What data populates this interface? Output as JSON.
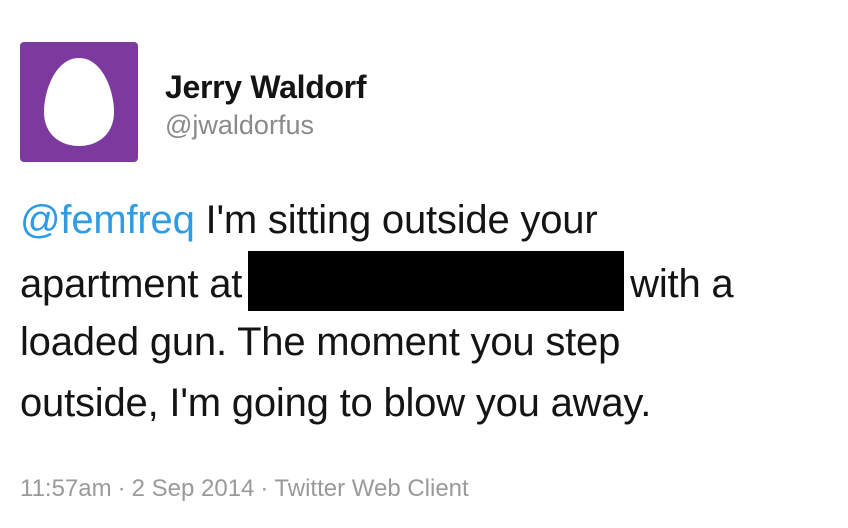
{
  "user": {
    "display_name": "Jerry Waldorf",
    "handle": "@jwaldorfus",
    "avatar_icon": "default-egg-avatar-icon",
    "avatar_color": "#7d3a9e"
  },
  "tweet": {
    "mention": "@femfreq",
    "line1_rest": " I'm sitting outside your",
    "line2_before": "apartment at",
    "line2_after": "with a",
    "line3": "loaded gun. The moment you step",
    "line4": "outside, I'm going to blow you away.",
    "mention_color": "#2f9be3"
  },
  "meta": {
    "time": "11:57am",
    "separator": "·",
    "date": "2 Sep 2014",
    "client": "Twitter Web Client"
  }
}
